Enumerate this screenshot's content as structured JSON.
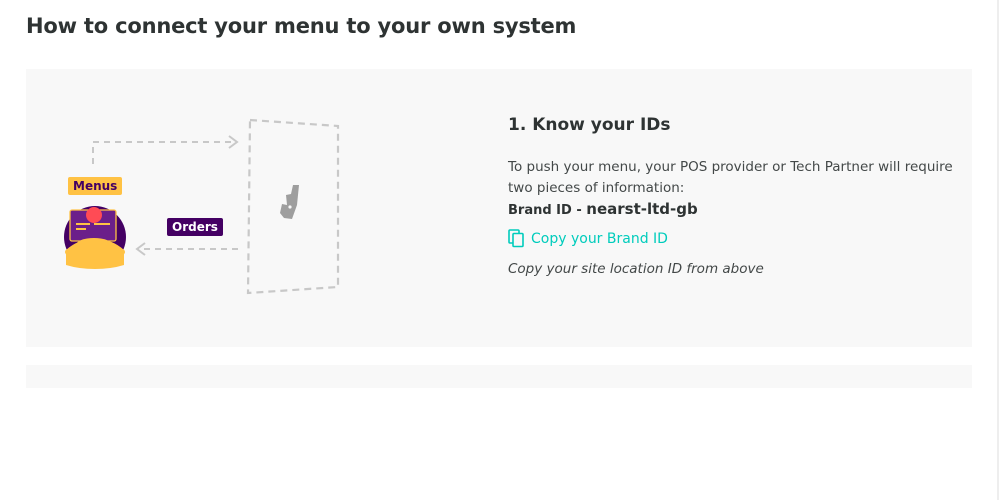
{
  "page": {
    "title": "How to connect your menu to your own system"
  },
  "illustration": {
    "menus_tag": "Menus",
    "orders_tag": "Orders",
    "icons": [
      "person-at-laptop-icon",
      "deliveroo-kangaroo-icon"
    ]
  },
  "step": {
    "title": "1. Know your IDs",
    "description": "To push your menu, your POS provider or Tech Partner will require two pieces of information:",
    "brand_label": "Brand ID - ",
    "brand_value": "nearst-ltd-gb",
    "copy_label": "Copy your Brand ID",
    "note": "Copy your site location ID from above"
  },
  "colors": {
    "accent": "#00ccbc",
    "purple": "#440063",
    "yellow": "#ffc244",
    "card_bg": "#f8f8f8",
    "text": "#2e3333"
  }
}
